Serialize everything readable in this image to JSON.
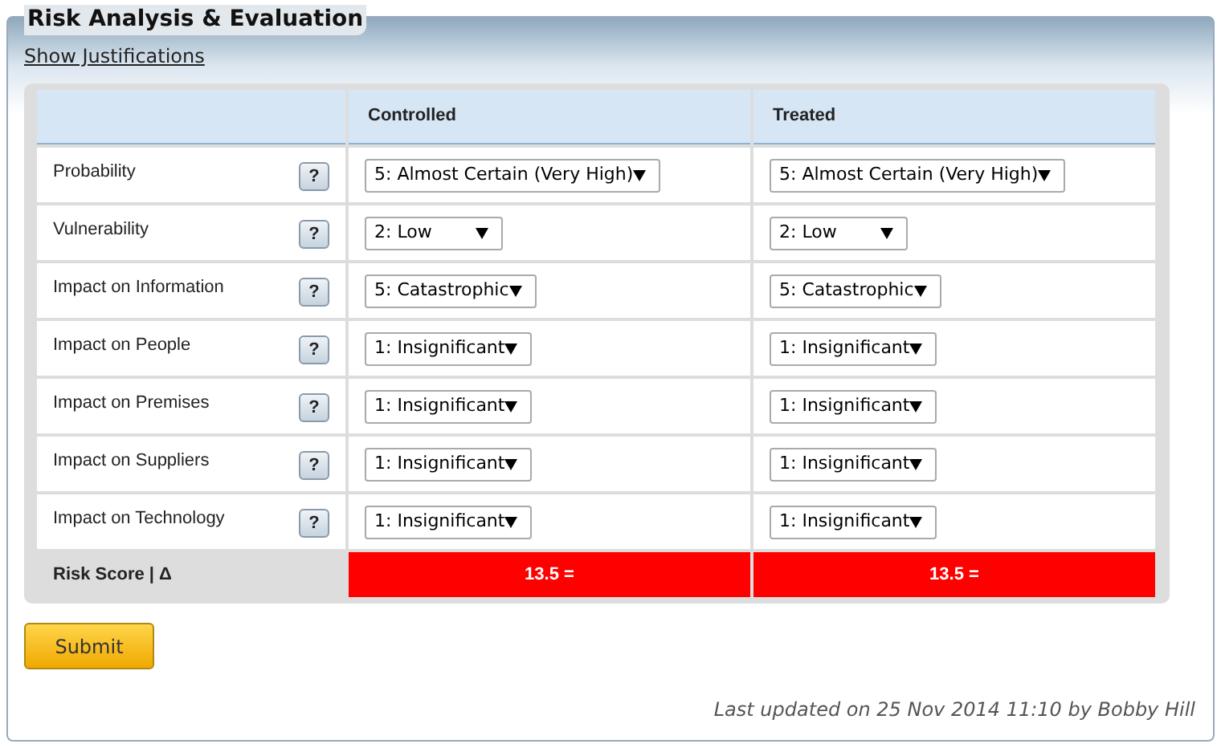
{
  "panel": {
    "title": "Risk Analysis & Evaluation",
    "link": "Show Justifications"
  },
  "table": {
    "columns": [
      "Controlled",
      "Treated"
    ],
    "rows": [
      {
        "label": "Probability",
        "help": "?",
        "values": [
          "5: Almost Certain (Very High)",
          "5: Almost Certain (Very High)"
        ]
      },
      {
        "label": "Vulnerability",
        "help": "?",
        "values": [
          "2: Low",
          "2: Low"
        ]
      },
      {
        "label": "Impact on Information",
        "help": "?",
        "values": [
          "5: Catastrophic",
          "5: Catastrophic"
        ]
      },
      {
        "label": "Impact on People",
        "help": "?",
        "values": [
          "1: Insignificant",
          "1: Insignificant"
        ]
      },
      {
        "label": "Impact on Premises",
        "help": "?",
        "values": [
          "1: Insignificant",
          "1: Insignificant"
        ]
      },
      {
        "label": "Impact on Suppliers",
        "help": "?",
        "values": [
          "1: Insignificant",
          "1: Insignificant"
        ]
      },
      {
        "label": "Impact on Technology",
        "help": "?",
        "values": [
          "1: Insignificant",
          "1: Insignificant"
        ]
      }
    ],
    "score": {
      "label": "Risk Score | Δ",
      "cells": [
        {
          "text": "13.5 =",
          "color": "#ff0000"
        },
        {
          "text": "13.5 =",
          "color": "#ff0000"
        }
      ]
    }
  },
  "submit": "Submit",
  "footer": "Last updated on 25 Nov 2014 11:10 by Bobby Hill"
}
